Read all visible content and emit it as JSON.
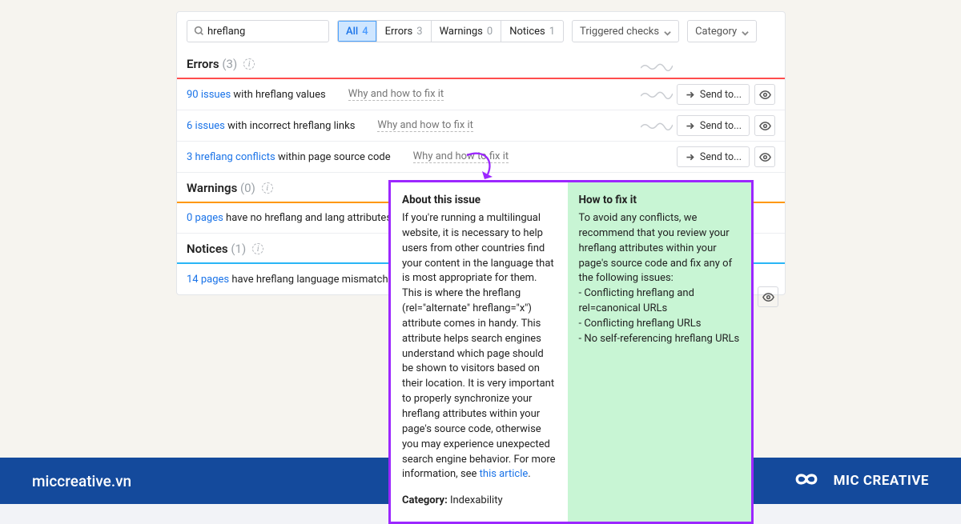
{
  "search": {
    "value": "hreflang"
  },
  "tabs": {
    "all": {
      "label": "All",
      "count": "4"
    },
    "errors": {
      "label": "Errors",
      "count": "3"
    },
    "warnings": {
      "label": "Warnings",
      "count": "0"
    },
    "notices": {
      "label": "Notices",
      "count": "1"
    }
  },
  "dropdowns": {
    "triggered": "Triggered checks",
    "category": "Category"
  },
  "sections": {
    "errors": {
      "title": "Errors",
      "count": "(3)"
    },
    "warnings": {
      "title": "Warnings",
      "count": "(0)"
    },
    "notices": {
      "title": "Notices",
      "count": "(1)"
    }
  },
  "rows": {
    "e1": {
      "link": "90 issues",
      "rest": " with hreflang values",
      "fix": "Why and how to fix it"
    },
    "e2": {
      "link": "6 issues",
      "rest": " with incorrect hreflang links",
      "fix": "Why and how to fix it"
    },
    "e3": {
      "link": "3 hreflang conflicts",
      "rest": " within page source code",
      "fix": "Why and how to fix it"
    },
    "w1": {
      "link": "0 pages",
      "rest": " have no hreflang and lang attributes"
    },
    "n1": {
      "link": "14 pages",
      "rest": " have hreflang language mismatch issues"
    }
  },
  "button": {
    "sendto": "Send to..."
  },
  "popover": {
    "about_h": "About this issue",
    "about_p1": "If you're running a multilingual website, it is necessary to help users from other countries find your content in the language that is most appropriate for them. This is where the hreflang (rel=\"alternate\" hreflang=\"x\") attribute comes in handy. This attribute helps search engines understand which page should be shown to visitors based on their location. It is very important to properly synchronize your hreflang attributes within your page's source code, otherwise you may experience unexpected search engine behavior. For more information, see ",
    "article": "this article",
    "period": ".",
    "cat_label": "Category:",
    "cat_value": " Indexability",
    "fix_h": "How to fix it",
    "fix_p": "To avoid any conflicts, we recommend that you review your hreflang attributes within your page's source code and fix any of the following issues:\n- Conflicting hreflang and rel=canonical URLs\n- Conflicting hreflang URLs\n- No self-referencing hreflang URLs"
  },
  "footer": {
    "url": "miccreative.vn",
    "brand": "MIC CREATIVE"
  }
}
